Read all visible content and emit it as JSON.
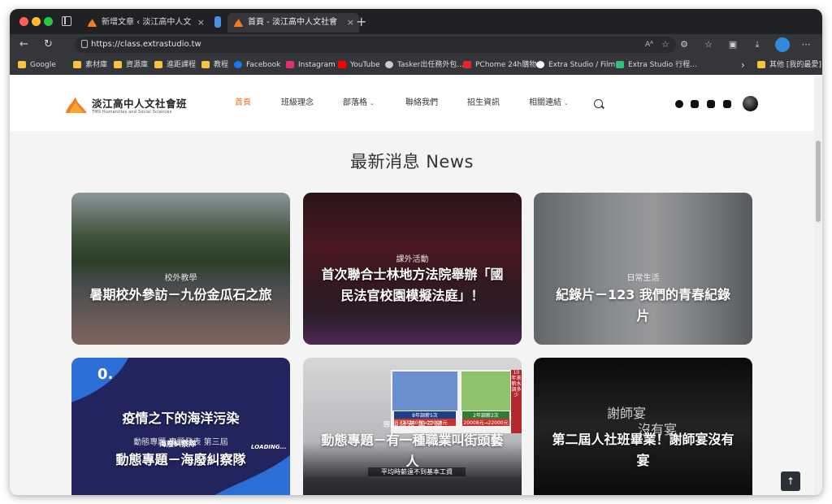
{
  "browser": {
    "tabs": [
      {
        "title": "新增文章 ‹ 淡江高中人文社會班",
        "close": "×"
      },
      {
        "title": "首頁 - 淡江高中人文社會班 TMS",
        "close": "×"
      }
    ],
    "new_tab": "+",
    "url": "https://class.extrastudio.tw",
    "url_icons": {
      "read_aloud": "Aᴬ",
      "favorite": "☆"
    },
    "bookmarks": [
      {
        "label": "Google",
        "icon": "folder-icon",
        "color": "#f5c542"
      },
      {
        "label": "素材庫",
        "icon": "folder-icon",
        "color": "#f5c542"
      },
      {
        "label": "資源庫",
        "icon": "folder-icon",
        "color": "#f5c542"
      },
      {
        "label": "進距課程",
        "icon": "folder-icon",
        "color": "#f5c542"
      },
      {
        "label": "教程",
        "icon": "folder-icon",
        "color": "#f5c542"
      },
      {
        "label": "Facebook",
        "icon": "facebook-icon",
        "color": "#1877f2"
      },
      {
        "label": "Instagram",
        "icon": "instagram-icon",
        "color": "#e1306c"
      },
      {
        "label": "YouTube",
        "icon": "youtube-icon",
        "color": "#ff0000"
      },
      {
        "label": "Tasker出任務外包...",
        "icon": "tasker-icon",
        "color": "#cccccc"
      },
      {
        "label": "PChome 24h購物",
        "icon": "pchome-icon",
        "color": "#e3262e"
      },
      {
        "label": "Extra Studio / Film",
        "icon": "extra-studio-icon",
        "color": "#ffffff"
      },
      {
        "label": "Extra Studio 行程...",
        "icon": "extra-studio-schedule-icon",
        "color": "#2ec27e"
      }
    ],
    "bookmarks_more": "›",
    "other_bookmarks": "其他 [我的最愛]"
  },
  "site": {
    "logo_title": "淡江高中人文社會班",
    "logo_subtitle": "TMS Humanities and Social Sciences",
    "accent_color": "#e8731c",
    "menu": [
      {
        "label": "首頁",
        "active": true,
        "dropdown": false
      },
      {
        "label": "班級理念",
        "active": false,
        "dropdown": false
      },
      {
        "label": "部落格",
        "active": false,
        "dropdown": true
      },
      {
        "label": "聯絡我們",
        "active": false,
        "dropdown": false
      },
      {
        "label": "招生資訊",
        "active": false,
        "dropdown": false
      },
      {
        "label": "相關連結",
        "active": false,
        "dropdown": true
      }
    ],
    "chevron": "⌄",
    "social_icons": [
      "facebook-icon",
      "instagram-icon",
      "youtube-icon",
      "discord-icon"
    ]
  },
  "news": {
    "heading": "最新消息 News",
    "cards": [
      {
        "category": "校外教學",
        "title": "暑期校外參訪－九份金瓜石之旅"
      },
      {
        "category": "課外活動",
        "title": "首次聯合士林地方法院舉辦「國民法官校園模擬法庭」！"
      },
      {
        "category": "日常生活",
        "title": "紀錄片－123 我們的青春紀錄片"
      },
      {
        "category": "動態專題 專題發表 第三屆",
        "title_top": "疫情之下的海洋污染",
        "title": "動態專題－海廢糾察隊",
        "image_text": [
          "0.",
          "LOADING...",
          "海廢糾察隊"
        ]
      },
      {
        "category": "專題發表 第三屆",
        "title": "動態專題－有一種職業叫街頭藝人",
        "image_text": [
          "10年來薪水調多少",
          "8年調薪5次",
          "17280元→20008元",
          "2年調薪2次",
          "20008元→22000元",
          "平均時薪遠不到基本工資"
        ]
      },
      {
        "category": "",
        "title": "第二屆人社班畢業！謝師宴沒有宴",
        "image_text": [
          "謝師宴",
          "沒有宴"
        ]
      }
    ]
  },
  "back_to_top": "↑"
}
